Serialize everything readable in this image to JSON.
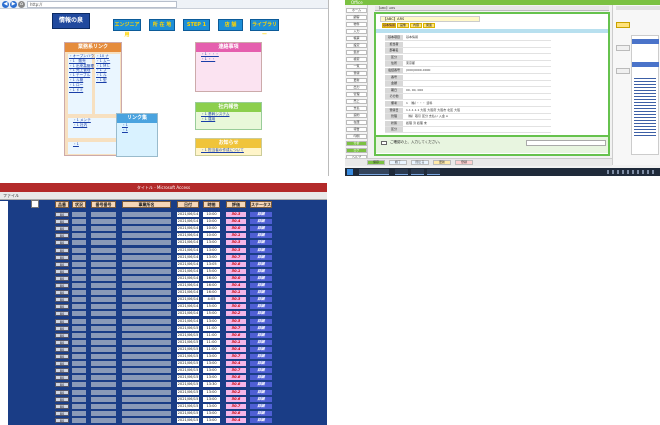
{
  "browser": {
    "url": "http://",
    "logo": "情報の泉",
    "nav": [
      "エンジニア用",
      "所 在 地",
      "STEP 1",
      "店 舗",
      "ライブラリー"
    ],
    "panels": [
      {
        "title": "業務系リンク",
        "links": [
          "・オープンハウス",
          "・1　販売",
          "・1 出来高管理",
          "・1 売上管理",
          "・1 テーブル",
          "・1 ル管",
          "・1 ロー",
          "・1 ドミ"
        ],
        "links2": [
          "・10 ナ",
          "・1 ムー",
          "・1 ＭＬ",
          "・1 ブ",
          "・1 ル",
          "・1 型"
        ]
      },
      {
        "title": "社内連絡",
        "links": [
          "・1 メンテ",
          "・1 社内"
        ]
      },
      {
        "title": "リンク集",
        "links": [
          "・1",
          "・1"
        ]
      },
      {
        "title": "連絡事項",
        "links": [
          "・1 ・・・",
          "・1 ・・"
        ]
      },
      {
        "title": "社内報告",
        "links": [
          "・1 基幹システム",
          "・1 運用"
        ]
      },
      {
        "title": "お知らせ",
        "links": [
          "・1 担当者の作成について"
        ]
      }
    ]
  },
  "crm": {
    "title": "Office",
    "window_title": "【ABC】ARS",
    "left_buttons": [
      "ホーム",
      "顧客",
      "物件",
      "入力",
      "帳票",
      "設定",
      "集計",
      "検索",
      "一覧",
      "登録",
      "更新",
      "出力",
      "管理",
      "売上",
      "支払",
      "契約",
      "在庫",
      "報告",
      "印刷",
      "分析",
      "ログ",
      "ヘルプ"
    ],
    "tabs": [
      "基本情報",
      "画像",
      "内容",
      "関連"
    ],
    "fields": [
      {
        "k": "基本項目",
        "v": "基本情報"
      },
      {
        "k": "担当者",
        "v": ""
      },
      {
        "k": "部署名",
        "v": ""
      },
      {
        "k": "区分",
        "v": ""
      },
      {
        "k": "住所",
        "v": "東京都"
      },
      {
        "k": "電話番号",
        "v": "(000)0000-0000"
      },
      {
        "k": "番号",
        "v": ""
      },
      {
        "k": "金額",
        "v": ""
      },
      {
        "k": "期日",
        "v": "00, 00, 000"
      },
      {
        "k": "その他",
        "v": ""
      },
      {
        "k": "備考",
        "v": "1 （株）・・・ 資料"
      },
      {
        "k": "登録日",
        "v": "1.1.1.1.1 大阪 大阪府 大阪市 北区 大阪"
      },
      {
        "k": "管理",
        "v": "（株）取引 区分 支払い 入金 A"
      },
      {
        "k": "状態",
        "v": "処理 済 処理 未"
      },
      {
        "k": "区分",
        "v": ""
      }
    ],
    "note": "ご確認の上、入力してください。",
    "bottom_buttons": [
      "保存",
      "終了",
      "閉じる",
      "更新",
      "登録"
    ]
  },
  "table": {
    "title": "タイトル - Microsoft Access",
    "menu": "ファイル",
    "headers": [
      "品番",
      "状況",
      "番号番号",
      "事業所名",
      "日付",
      "時間",
      "評価",
      "ステータス"
    ],
    "rows": [
      [
        "80",
        "2021/06/14",
        "10:00",
        "50.3",
        "詳細"
      ],
      [
        "80",
        "2021/06/14",
        "10:00",
        "50.4",
        "詳細"
      ],
      [
        "80",
        "2021/06/14",
        "10:00",
        "50.0",
        "詳細"
      ],
      [
        "80",
        "2021/06/14",
        "10:00",
        "50.1",
        "詳細"
      ],
      [
        "80",
        "2021/06/14",
        "13:00",
        "50.3",
        "詳細"
      ],
      [
        "80",
        "2021/06/14",
        "13:00",
        "50.3",
        "詳細"
      ],
      [
        "80",
        "2021/06/14",
        "13:00",
        "50.7",
        "詳細"
      ],
      [
        "80",
        "2021/06/14",
        "13:05",
        "50.8",
        "詳細"
      ],
      [
        "80",
        "2021/06/14",
        "15:00",
        "50.1",
        "詳細"
      ],
      [
        "80",
        "2021/06/14",
        "16:00",
        "50.0",
        "詳細"
      ],
      [
        "80",
        "2021/06/14",
        "16:00",
        "50.4",
        "詳細"
      ],
      [
        "80",
        "2021/06/14",
        "16:00",
        "50.1",
        "詳細"
      ],
      [
        "80",
        "2021/06/14",
        "4:05",
        "50.3",
        "詳細"
      ],
      [
        "80",
        "2021/06/14",
        "15:00",
        "50.0",
        "詳細"
      ],
      [
        "80",
        "2021/06/14",
        "15:00",
        "50.2",
        "詳細"
      ],
      [
        "80",
        "2021/06/14",
        "13:00",
        "50.5",
        "詳細"
      ],
      [
        "80",
        "2021/06/15",
        "11:00",
        "50.7",
        "詳細"
      ],
      [
        "80",
        "2021/06/15",
        "11:00",
        "50.8",
        "詳細"
      ],
      [
        "80",
        "2021/06/15",
        "11:00",
        "50.1",
        "詳細"
      ],
      [
        "80",
        "2021/06/15",
        "11:00",
        "50.4",
        "詳細"
      ],
      [
        "80",
        "2021/06/15",
        "13:00",
        "50.7",
        "詳細"
      ],
      [
        "80",
        "2021/06/15",
        "13:00",
        "50.4",
        "詳細"
      ],
      [
        "80",
        "2021/06/15",
        "13:00",
        "50.7",
        "詳細"
      ],
      [
        "80",
        "2021/06/15",
        "13:00",
        "50.8",
        "詳細"
      ],
      [
        "80",
        "2021/06/15",
        "13:30",
        "50.8",
        "詳細"
      ],
      [
        "80",
        "2021/06/15",
        "13:00",
        "50.2",
        "詳細"
      ],
      [
        "80",
        "2021/06/15",
        "13:00",
        "50.6",
        "詳細"
      ],
      [
        "80",
        "2021/06/15",
        "13:00",
        "50.7",
        "詳細"
      ],
      [
        "80",
        "2021/06/15",
        "13:00",
        "50.8",
        "詳細"
      ],
      [
        "80",
        "2021/06/15",
        "13:00",
        "50.4",
        "詳細"
      ]
    ]
  }
}
